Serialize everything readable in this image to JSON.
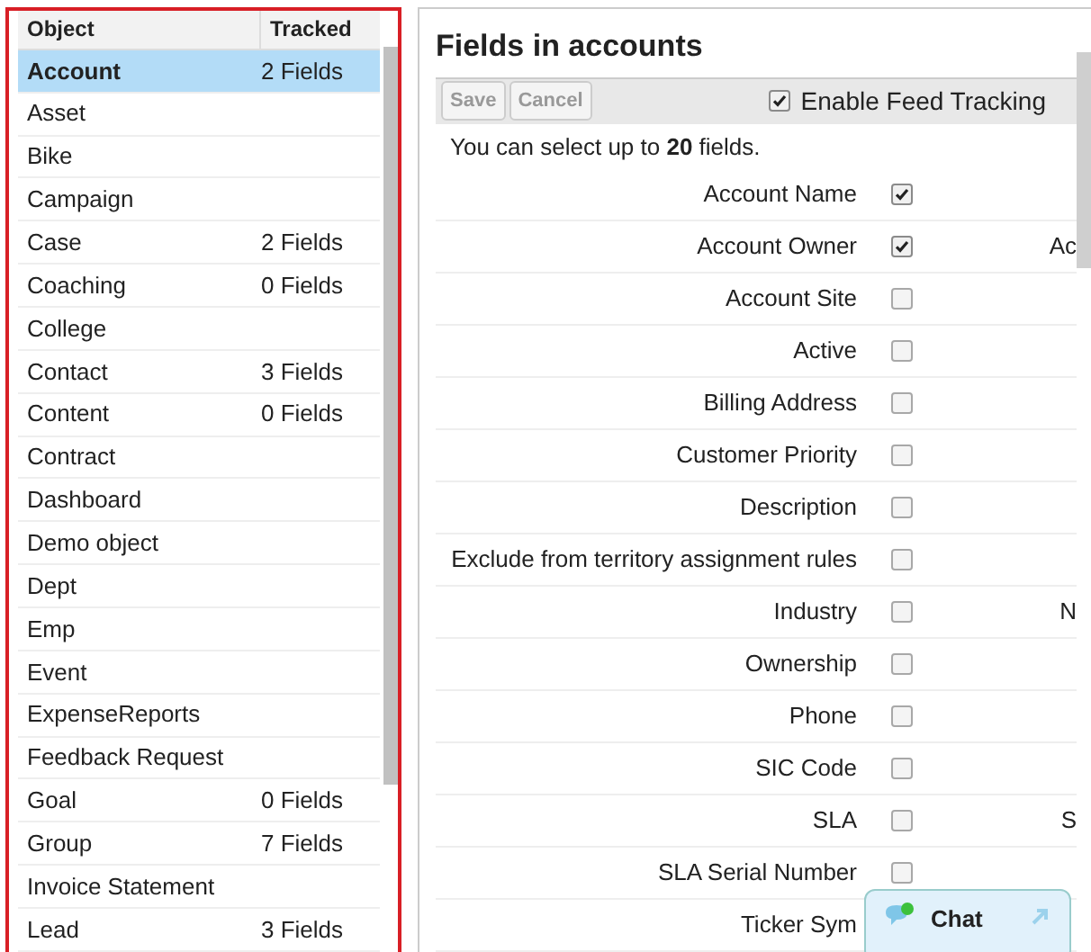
{
  "objects_table": {
    "columns": [
      "Object",
      "Tracked"
    ],
    "rows": [
      {
        "name": "Account",
        "tracked": "2 Fields",
        "selected": true
      },
      {
        "name": "Asset",
        "selected": false
      },
      {
        "name": "Bike",
        "selected": false
      },
      {
        "name": "Campaign",
        "selected": false
      },
      {
        "name": "Case",
        "tracked": "2 Fields",
        "selected": false
      },
      {
        "name": "Coaching",
        "tracked": "0 Fields",
        "selected": false
      },
      {
        "name": "College",
        "selected": false
      },
      {
        "name": "Contact",
        "tracked": "3 Fields",
        "selected": false
      },
      {
        "name": "Content",
        "tracked": "0 Fields",
        "selected": false
      },
      {
        "name": "Contract",
        "selected": false
      },
      {
        "name": "Dashboard",
        "selected": false
      },
      {
        "name": "Demo object",
        "selected": false
      },
      {
        "name": "Dept",
        "selected": false
      },
      {
        "name": "Emp",
        "selected": false
      },
      {
        "name": "Event",
        "selected": false
      },
      {
        "name": "ExpenseReports",
        "selected": false
      },
      {
        "name": "Feedback Request",
        "selected": false
      },
      {
        "name": "Goal",
        "tracked": "0 Fields",
        "selected": false
      },
      {
        "name": "Group",
        "tracked": "7 Fields",
        "selected": false
      },
      {
        "name": "Invoice Statement",
        "selected": false
      },
      {
        "name": "Lead",
        "tracked": "3 Fields",
        "selected": false
      }
    ]
  },
  "fields_panel": {
    "title": "Fields in accounts",
    "buttons": [
      {
        "label": "Save",
        "disabled": true
      },
      {
        "label": "Cancel",
        "disabled": true
      }
    ],
    "feed_tracking": {
      "label": "Enable Feed Tracking",
      "checked": true
    },
    "hint": "You can select up to **20** fields.",
    "fields": [
      {
        "label": "Account Name",
        "checked": true
      },
      {
        "label": "Account Owner",
        "checked": true,
        "column_3": "Ac"
      },
      {
        "label": "Account Site",
        "checked": false
      },
      {
        "label": "Active",
        "checked": false
      },
      {
        "label": "Billing Address",
        "checked": false
      },
      {
        "label": "Customer Priority",
        "checked": false
      },
      {
        "label": "Description",
        "checked": false
      },
      {
        "label": "Exclude from territory assignment rules",
        "checked": false
      },
      {
        "label": "Industry",
        "checked": false,
        "column_3": "N"
      },
      {
        "label": "Ownership",
        "checked": false
      },
      {
        "label": "Phone",
        "checked": false
      },
      {
        "label": "SIC Code",
        "checked": false
      },
      {
        "label": "SLA",
        "checked": false,
        "column_3": "S"
      },
      {
        "label": "SLA Serial Number",
        "checked": false
      },
      {
        "label": "Ticker Sym"
      }
    ]
  },
  "chat": {
    "label": "Chat"
  }
}
